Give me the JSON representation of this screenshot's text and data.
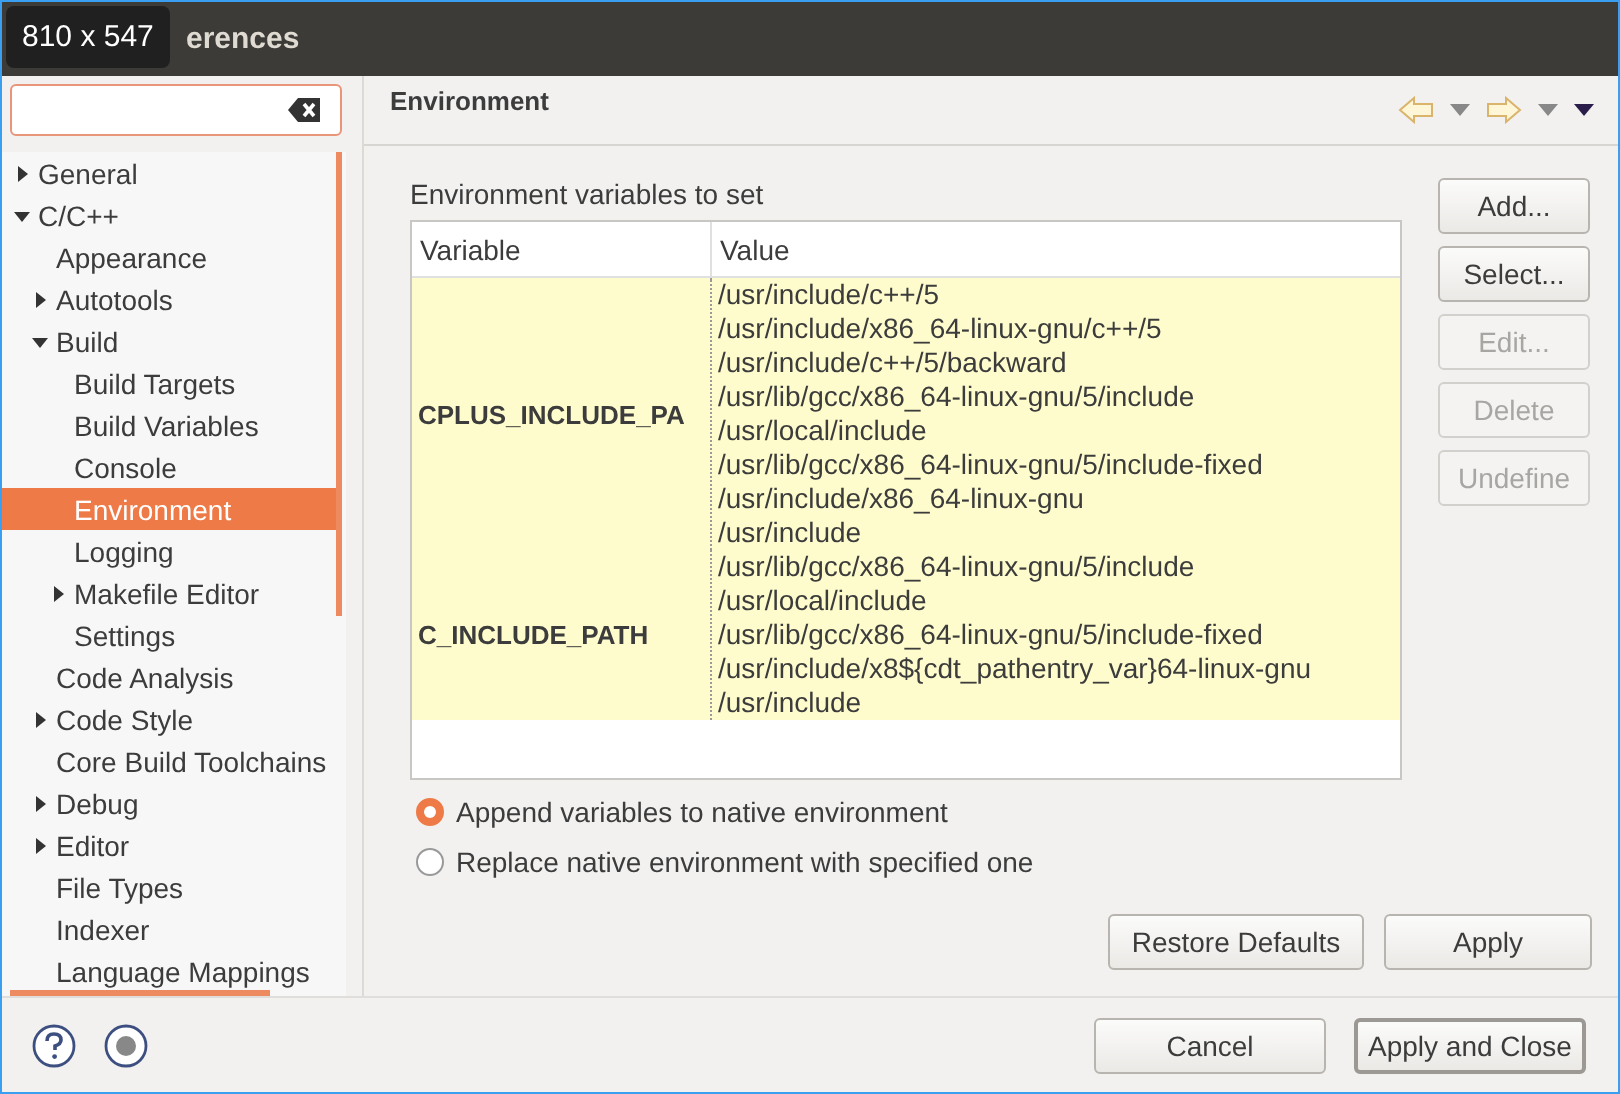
{
  "window": {
    "title": "erences",
    "size_badge": "810 x 547"
  },
  "sidebar": {
    "tree": [
      {
        "label": "General",
        "expanded": false,
        "selected": false
      },
      {
        "label": "C/C++",
        "expanded": true,
        "selected": false,
        "children": [
          {
            "label": "Appearance",
            "selected": false
          },
          {
            "label": "Autotools",
            "expanded": false,
            "selected": false
          },
          {
            "label": "Build",
            "expanded": true,
            "selected": false,
            "children": [
              {
                "label": "Build Targets",
                "selected": false
              },
              {
                "label": "Build Variables",
                "selected": false
              },
              {
                "label": "Console",
                "selected": false
              },
              {
                "label": "Environment",
                "selected": true
              },
              {
                "label": "Logging",
                "selected": false
              },
              {
                "label": "Makefile Editor",
                "expanded": false,
                "selected": false
              },
              {
                "label": "Settings",
                "selected": false
              }
            ]
          },
          {
            "label": "Code Analysis",
            "selected": false
          },
          {
            "label": "Code Style",
            "expanded": false,
            "selected": false
          },
          {
            "label": "Core Build Toolchains",
            "selected": false
          },
          {
            "label": "Debug",
            "expanded": false,
            "selected": false
          },
          {
            "label": "Editor",
            "expanded": false,
            "selected": false
          },
          {
            "label": "File Types",
            "selected": false
          },
          {
            "label": "Indexer",
            "selected": false
          },
          {
            "label": "Language Mappings",
            "selected": false
          }
        ]
      }
    ]
  },
  "page": {
    "title": "Environment",
    "section_label": "Environment variables to set",
    "table": {
      "columns": [
        "Variable",
        "Value"
      ],
      "rows": [
        {
          "variable": "CPLUS_INCLUDE_PA",
          "value": [
            "/usr/include/c++/5",
            "/usr/include/x86_64-linux-gnu/c++/5",
            "/usr/include/c++/5/backward",
            "/usr/lib/gcc/x86_64-linux-gnu/5/include",
            "/usr/local/include",
            "/usr/lib/gcc/x86_64-linux-gnu/5/include-fixed",
            "/usr/include/x86_64-linux-gnu",
            "/usr/include"
          ]
        },
        {
          "variable": "C_INCLUDE_PATH",
          "value": [
            "/usr/lib/gcc/x86_64-linux-gnu/5/include",
            "/usr/local/include",
            "/usr/lib/gcc/x86_64-linux-gnu/5/include-fixed",
            "/usr/include/x8${cdt_pathentry_var}64-linux-gnu",
            "/usr/include"
          ]
        }
      ]
    },
    "side_buttons": [
      {
        "label": "Add...",
        "disabled": false
      },
      {
        "label": "Select...",
        "disabled": false
      },
      {
        "label": "Edit...",
        "disabled": true
      },
      {
        "label": "Delete",
        "disabled": true
      },
      {
        "label": "Undefine",
        "disabled": true
      }
    ],
    "options": [
      {
        "label": "Append variables to native environment",
        "selected": true
      },
      {
        "label": "Replace native environment with specified one",
        "selected": false
      }
    ],
    "buttons": [
      "Restore Defaults",
      "Apply"
    ]
  },
  "footer": {
    "buttons": [
      {
        "label": "Cancel",
        "default": false
      },
      {
        "label": "Apply and Close",
        "default": true
      }
    ]
  }
}
